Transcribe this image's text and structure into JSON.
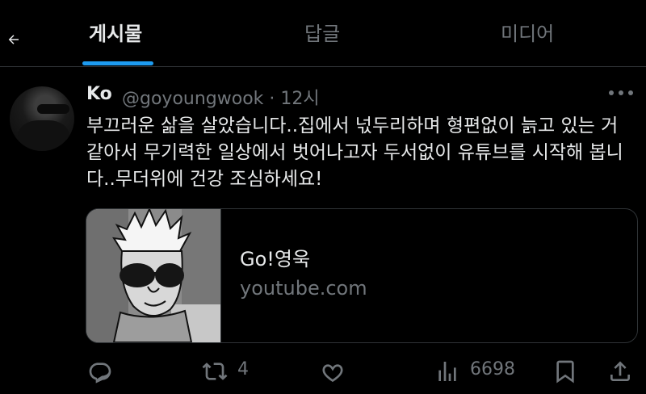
{
  "tabs": [
    {
      "label": "게시물",
      "active": true
    },
    {
      "label": "답글",
      "active": false
    },
    {
      "label": "미디어",
      "active": false
    }
  ],
  "tweet": {
    "name": "Ko",
    "handle_time": "@goyoungwook · 12시",
    "text": "부끄러운 삶을 살았습니다..집에서 넋두리하며 형편없이 늙고 있는 거 같아서 무기력한 일상에서 벗어나고자 두서없이 유튜브를 시작해 봅니다..무더위에 건강 조심하세요!",
    "card": {
      "title": "Go!영욱",
      "domain": "youtube.com"
    },
    "actions": {
      "retweets": "4",
      "views": "6698"
    }
  },
  "icons": {
    "back": "arrow-left-icon",
    "more": "ellipsis-icon",
    "reply": "reply-icon",
    "retweet": "retweet-icon",
    "like": "heart-icon",
    "views": "views-chart-icon",
    "bookmark": "bookmark-icon",
    "share": "share-icon"
  },
  "colors": {
    "accent": "#1d9bf0",
    "muted": "#71767b",
    "text": "#e7e9ea",
    "border": "#2f3336"
  }
}
